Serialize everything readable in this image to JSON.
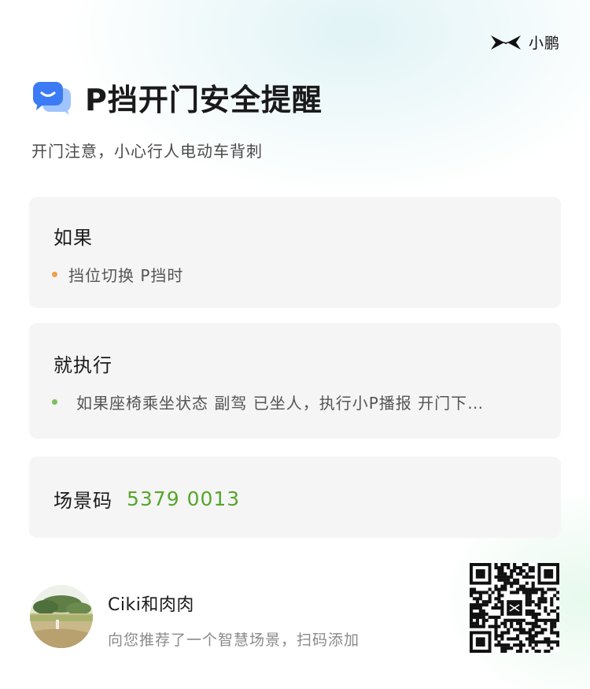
{
  "brand": {
    "logo_text": "小鹏"
  },
  "header": {
    "title": "P挡开门安全提醒",
    "subtitle": "开门注意，小心行人电动车背刺"
  },
  "cards": {
    "condition": {
      "heading": "如果",
      "item": "挡位切换 P挡时",
      "dot_color": "#f0a14a"
    },
    "action": {
      "heading": "就执行",
      "item": "如果座椅乘坐状态 副驾 已坐人，执行小P播报 开门下…",
      "dot_color": "#7cbf5a"
    },
    "code": {
      "label": "场景码",
      "value": "5379 0013",
      "value_color": "#57a62a"
    }
  },
  "footer": {
    "user_name": "Ciki和肉肉",
    "description": "向您推荐了一个智慧场景，扫码添加"
  },
  "icons": {
    "title_icon": "chat-bubble-icon",
    "brand_icon": "xpeng-logo-icon",
    "qr": "qr-code"
  }
}
